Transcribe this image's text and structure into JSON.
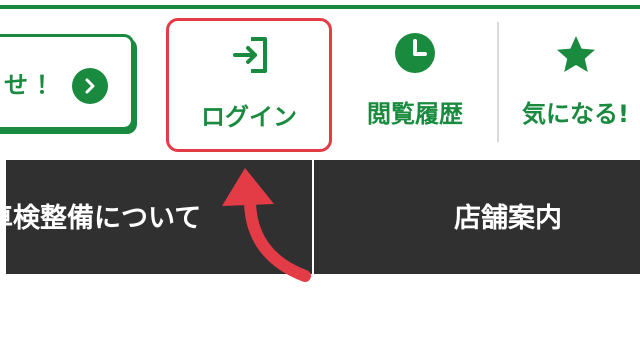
{
  "promo": {
    "text": "せ！",
    "button_icon": "chevron-right-icon"
  },
  "nav": {
    "login": {
      "label": "ログイン",
      "icon": "login-icon"
    },
    "history": {
      "label": "閲覧履歴",
      "icon": "clock-icon"
    },
    "favorites": {
      "label": "気になる!",
      "icon": "star-icon"
    }
  },
  "menu": {
    "inspection_label": "車検整備について",
    "stores_label": "店舗案内"
  },
  "colors": {
    "brand_green": "#1a8a3f",
    "highlight_red": "#e43c47",
    "bar_dark": "#303030"
  }
}
